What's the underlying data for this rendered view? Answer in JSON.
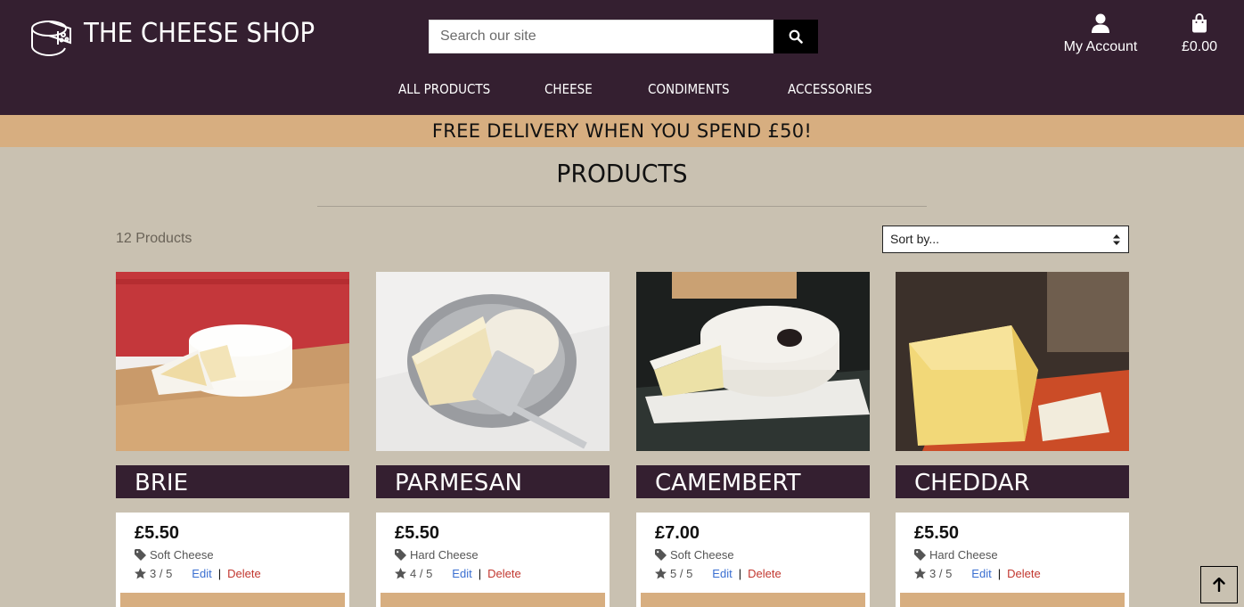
{
  "header": {
    "brand": "THE CHEESE SHOP",
    "search_placeholder": "Search our site",
    "account_label": "My Account",
    "bag_total": "£0.00",
    "nav": [
      "ALL PRODUCTS",
      "CHEESE",
      "CONDIMENTS",
      "ACCESSORIES"
    ]
  },
  "promo": "FREE DELIVERY WHEN YOU SPEND £50!",
  "page_title": "PRODUCTS",
  "toolbar": {
    "count": "12 Products",
    "sort_label": "Sort by..."
  },
  "products": [
    {
      "name": "BRIE",
      "price": "£5.50",
      "category": "Soft Cheese",
      "rating": "3 / 5",
      "edit": "Edit",
      "sep": "|",
      "delete": "Delete"
    },
    {
      "name": "PARMESAN",
      "price": "£5.50",
      "category": "Hard Cheese",
      "rating": "4 / 5",
      "edit": "Edit",
      "sep": "|",
      "delete": "Delete"
    },
    {
      "name": "CAMEMBERT",
      "price": "£7.00",
      "category": "Soft Cheese",
      "rating": "5 / 5",
      "edit": "Edit",
      "sep": "|",
      "delete": "Delete"
    },
    {
      "name": "CHEDDAR",
      "price": "£5.50",
      "category": "Hard Cheese",
      "rating": "3 / 5",
      "edit": "Edit",
      "sep": "|",
      "delete": "Delete"
    }
  ],
  "colors": {
    "header_bg": "#341f30",
    "accent": "#d7ae80",
    "page_bg": "#c9c1b1",
    "link": "#3a6fd1",
    "danger": "#c2372f"
  },
  "icons": [
    "cheese-logo-icon",
    "search-icon",
    "user-icon",
    "shopping-bag-icon",
    "tag-icon",
    "star-icon",
    "arrow-up-icon",
    "sort-arrows-icon"
  ]
}
